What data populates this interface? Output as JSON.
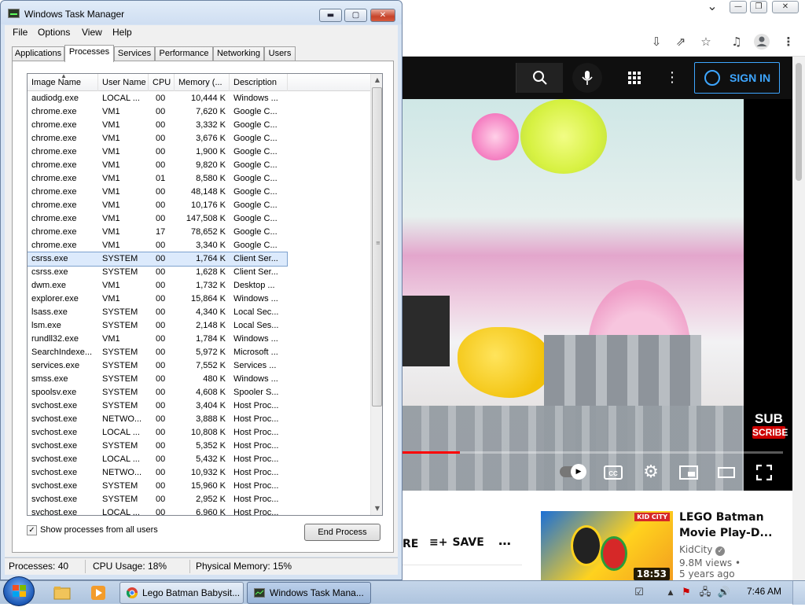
{
  "chrome": {
    "window_controls": {
      "chevron": "⌄",
      "minimize": "—",
      "restore": "❐",
      "close": "✕"
    },
    "toolbar_icons": [
      "download-icon",
      "share-icon",
      "bookmark-star-icon",
      "media-control-icon",
      "profile-icon",
      "menu-icon"
    ]
  },
  "youtube": {
    "sign_in": "SIGN IN",
    "subscribe_badge": {
      "line1": "SUB",
      "line2": "SCRIBE"
    },
    "progress_fraction": 0.15,
    "actions": {
      "partial_label": "RE",
      "save_label": "SAVE",
      "more_label": "⋯"
    },
    "recommended": {
      "title": "LEGO Batman Movie Play-D...",
      "channel": "KidCity",
      "views": "9.8M views •",
      "age": "5 years ago",
      "duration": "18:53",
      "brand": "KID CITY"
    }
  },
  "taskmgr": {
    "title": "Windows Task Manager",
    "menu": [
      "File",
      "Options",
      "View",
      "Help"
    ],
    "tabs": [
      "Applications",
      "Processes",
      "Services",
      "Performance",
      "Networking",
      "Users"
    ],
    "active_tab": "Processes",
    "columns": [
      "Image Name",
      "User Name",
      "CPU",
      "Memory (...",
      "Description"
    ],
    "rows": [
      [
        "audiodg.exe",
        "LOCAL ...",
        "00",
        "10,444 K",
        "Windows ..."
      ],
      [
        "chrome.exe",
        "VM1",
        "00",
        "7,620 K",
        "Google C..."
      ],
      [
        "chrome.exe",
        "VM1",
        "00",
        "3,332 K",
        "Google C..."
      ],
      [
        "chrome.exe",
        "VM1",
        "00",
        "3,676 K",
        "Google C..."
      ],
      [
        "chrome.exe",
        "VM1",
        "00",
        "1,900 K",
        "Google C..."
      ],
      [
        "chrome.exe",
        "VM1",
        "00",
        "9,820 K",
        "Google C..."
      ],
      [
        "chrome.exe",
        "VM1",
        "01",
        "8,580 K",
        "Google C..."
      ],
      [
        "chrome.exe",
        "VM1",
        "00",
        "48,148 K",
        "Google C..."
      ],
      [
        "chrome.exe",
        "VM1",
        "00",
        "10,176 K",
        "Google C..."
      ],
      [
        "chrome.exe",
        "VM1",
        "00",
        "147,508 K",
        "Google C..."
      ],
      [
        "chrome.exe",
        "VM1",
        "17",
        "78,652 K",
        "Google C..."
      ],
      [
        "chrome.exe",
        "VM1",
        "00",
        "3,340 K",
        "Google C..."
      ],
      [
        "csrss.exe",
        "SYSTEM",
        "00",
        "1,764 K",
        "Client Ser..."
      ],
      [
        "csrss.exe",
        "SYSTEM",
        "00",
        "1,628 K",
        "Client Ser..."
      ],
      [
        "dwm.exe",
        "VM1",
        "00",
        "1,732 K",
        "Desktop ..."
      ],
      [
        "explorer.exe",
        "VM1",
        "00",
        "15,864 K",
        "Windows ..."
      ],
      [
        "lsass.exe",
        "SYSTEM",
        "00",
        "4,340 K",
        "Local Sec..."
      ],
      [
        "lsm.exe",
        "SYSTEM",
        "00",
        "2,148 K",
        "Local Ses..."
      ],
      [
        "rundll32.exe",
        "VM1",
        "00",
        "1,784 K",
        "Windows ..."
      ],
      [
        "SearchIndexe...",
        "SYSTEM",
        "00",
        "5,972 K",
        "Microsoft ..."
      ],
      [
        "services.exe",
        "SYSTEM",
        "00",
        "7,552 K",
        "Services ..."
      ],
      [
        "smss.exe",
        "SYSTEM",
        "00",
        "480 K",
        "Windows ..."
      ],
      [
        "spoolsv.exe",
        "SYSTEM",
        "00",
        "4,608 K",
        "Spooler S..."
      ],
      [
        "svchost.exe",
        "SYSTEM",
        "00",
        "3,404 K",
        "Host Proc..."
      ],
      [
        "svchost.exe",
        "NETWO...",
        "00",
        "3,888 K",
        "Host Proc..."
      ],
      [
        "svchost.exe",
        "LOCAL ...",
        "00",
        "10,808 K",
        "Host Proc..."
      ],
      [
        "svchost.exe",
        "SYSTEM",
        "00",
        "5,352 K",
        "Host Proc..."
      ],
      [
        "svchost.exe",
        "LOCAL ...",
        "00",
        "5,432 K",
        "Host Proc..."
      ],
      [
        "svchost.exe",
        "NETWO...",
        "00",
        "10,932 K",
        "Host Proc..."
      ],
      [
        "svchost.exe",
        "SYSTEM",
        "00",
        "15,960 K",
        "Host Proc..."
      ],
      [
        "svchost.exe",
        "SYSTEM",
        "00",
        "2,952 K",
        "Host Proc..."
      ],
      [
        "svchost.exe",
        "LOCAL ...",
        "00",
        "6,960 K",
        "Host Proc..."
      ]
    ],
    "selected_row": 12,
    "show_all_label": "Show processes from all users",
    "show_all_checked": true,
    "end_process_label": "End Process",
    "status": {
      "processes": "Processes: 40",
      "cpu": "CPU Usage: 18%",
      "memory": "Physical Memory: 15%"
    }
  },
  "taskbar": {
    "tasks": [
      {
        "label": "Lego Batman Babysit...",
        "icon": "chrome-icon"
      },
      {
        "label": "Windows Task Mana...",
        "icon": "task-manager-icon"
      }
    ],
    "time": "7:46 AM"
  }
}
